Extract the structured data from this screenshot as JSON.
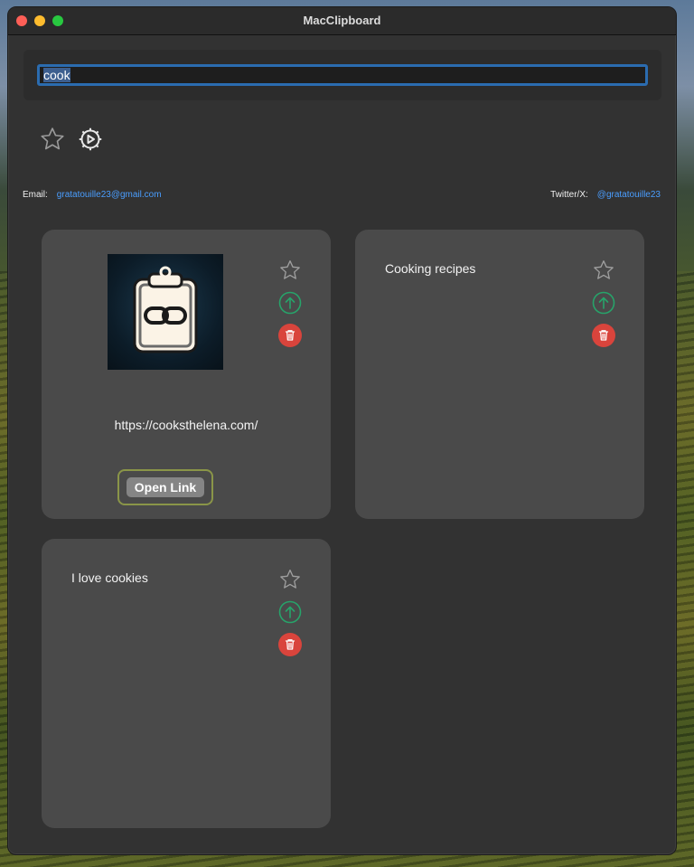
{
  "window": {
    "title": "MacClipboard"
  },
  "search": {
    "value": "cook",
    "placeholder": ""
  },
  "toolbar": {
    "favorites_icon": "star-icon",
    "settings_icon": "gear-play-icon"
  },
  "contact": {
    "email_label": "Email:",
    "email_value": "gratatouille23@gmail.com",
    "twitter_label": "Twitter/X:",
    "twitter_value": "@gratatouille23"
  },
  "cards": [
    {
      "type": "link",
      "thumbnail_icon": "clipboard-link-icon",
      "url": "https://cooksthelena.com/",
      "button_label": "Open Link"
    },
    {
      "type": "text",
      "text": "Cooking recipes"
    },
    {
      "type": "text",
      "text": "I love cookies"
    }
  ],
  "colors": {
    "accent": "#2b6cb0",
    "link": "#4a9eff",
    "copy_action": "#27a36a",
    "delete_action": "#d9443c",
    "card_bg": "#4a4a4a",
    "window_bg": "#323232"
  }
}
